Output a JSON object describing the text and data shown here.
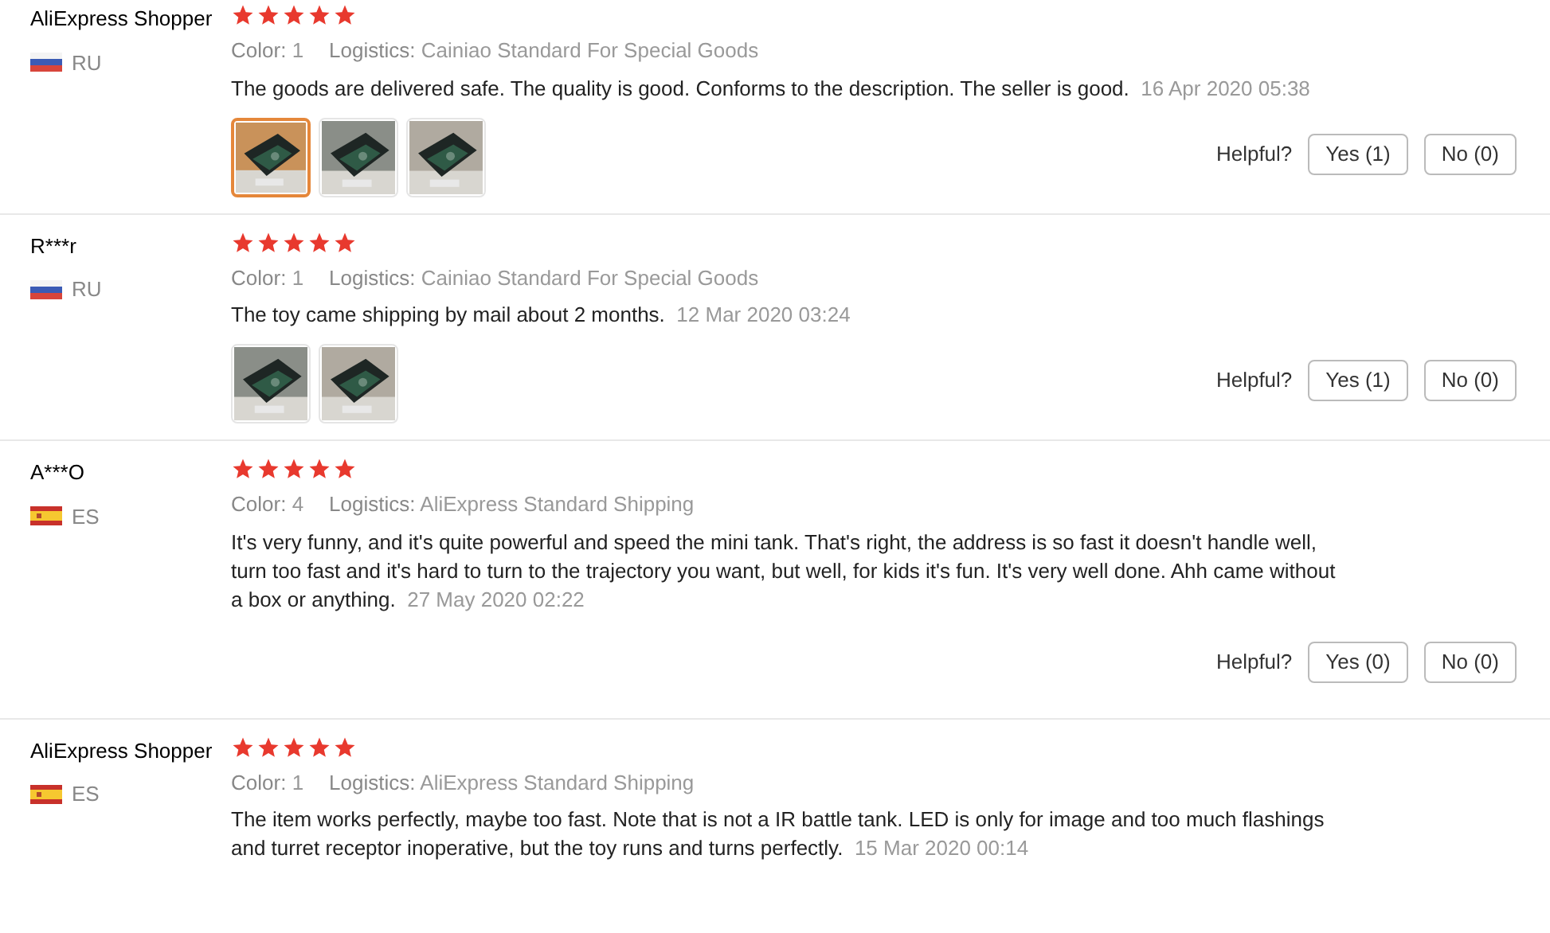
{
  "reviews": [
    {
      "user": "AliExpress Shopper",
      "kind": "russia",
      "country": "RU",
      "stars": 5,
      "color_label": "Color:",
      "color_value": "1",
      "logistics_label": "Logistics:",
      "logistics": "Cainiao Standard For Special Goods",
      "text": "The goods are delivered safe. The quality is good. Conforms to the description. The seller is good.",
      "date": "16 Apr 2020 05:38",
      "photos": [
        {
          "kind": "picture",
          "selected": true
        },
        {
          "kind": "picture",
          "selected": false
        },
        {
          "kind": "picture",
          "selected": false
        }
      ],
      "helpful": {
        "label": "Helpful?",
        "yes": "Yes (1)",
        "no": "No (0)"
      }
    },
    {
      "user": "R***r",
      "kind": "russia",
      "country": "RU",
      "stars": 5,
      "color_label": "Color:",
      "color_value": "1",
      "logistics_label": "Logistics:",
      "logistics": "Cainiao Standard For Special Goods",
      "text": "The toy came shipping by mail about 2 months.",
      "date": "12 Mar 2020 03:24",
      "photos": [
        {
          "kind": "picture",
          "selected": false
        },
        {
          "kind": "picture",
          "selected": false
        }
      ],
      "helpful": {
        "label": "Helpful?",
        "yes": "Yes (1)",
        "no": "No (0)"
      }
    },
    {
      "user": "A***O",
      "kind": "spain",
      "country": "ES",
      "stars": 5,
      "color_label": "Color:",
      "color_value": "4",
      "logistics_label": "Logistics:",
      "logistics": "AliExpress Standard Shipping",
      "text": "It's very funny, and it's quite powerful and speed the mini tank. That's right, the address is so fast it doesn't handle well, turn too fast and it's hard to turn to the trajectory you want, but well, for kids it's fun. It's very well done. Ahh came without a box or anything.",
      "date": "27 May 2020 02:22",
      "helpful": {
        "label": "Helpful?",
        "yes": "Yes (0)",
        "no": "No (0)"
      }
    },
    {
      "user": "AliExpress Shopper",
      "kind": "spain",
      "country": "ES",
      "stars": 5,
      "color_label": "Color:",
      "color_value": "1",
      "logistics_label": "Logistics:",
      "logistics": "AliExpress Standard Shipping",
      "text": "The item works perfectly, maybe too fast. Note that is not a IR battle tank. LED is only for image and too much flashings and turret receptor inoperative, but the toy runs and turns perfectly.",
      "date": "15 Mar 2020 00:14"
    }
  ]
}
